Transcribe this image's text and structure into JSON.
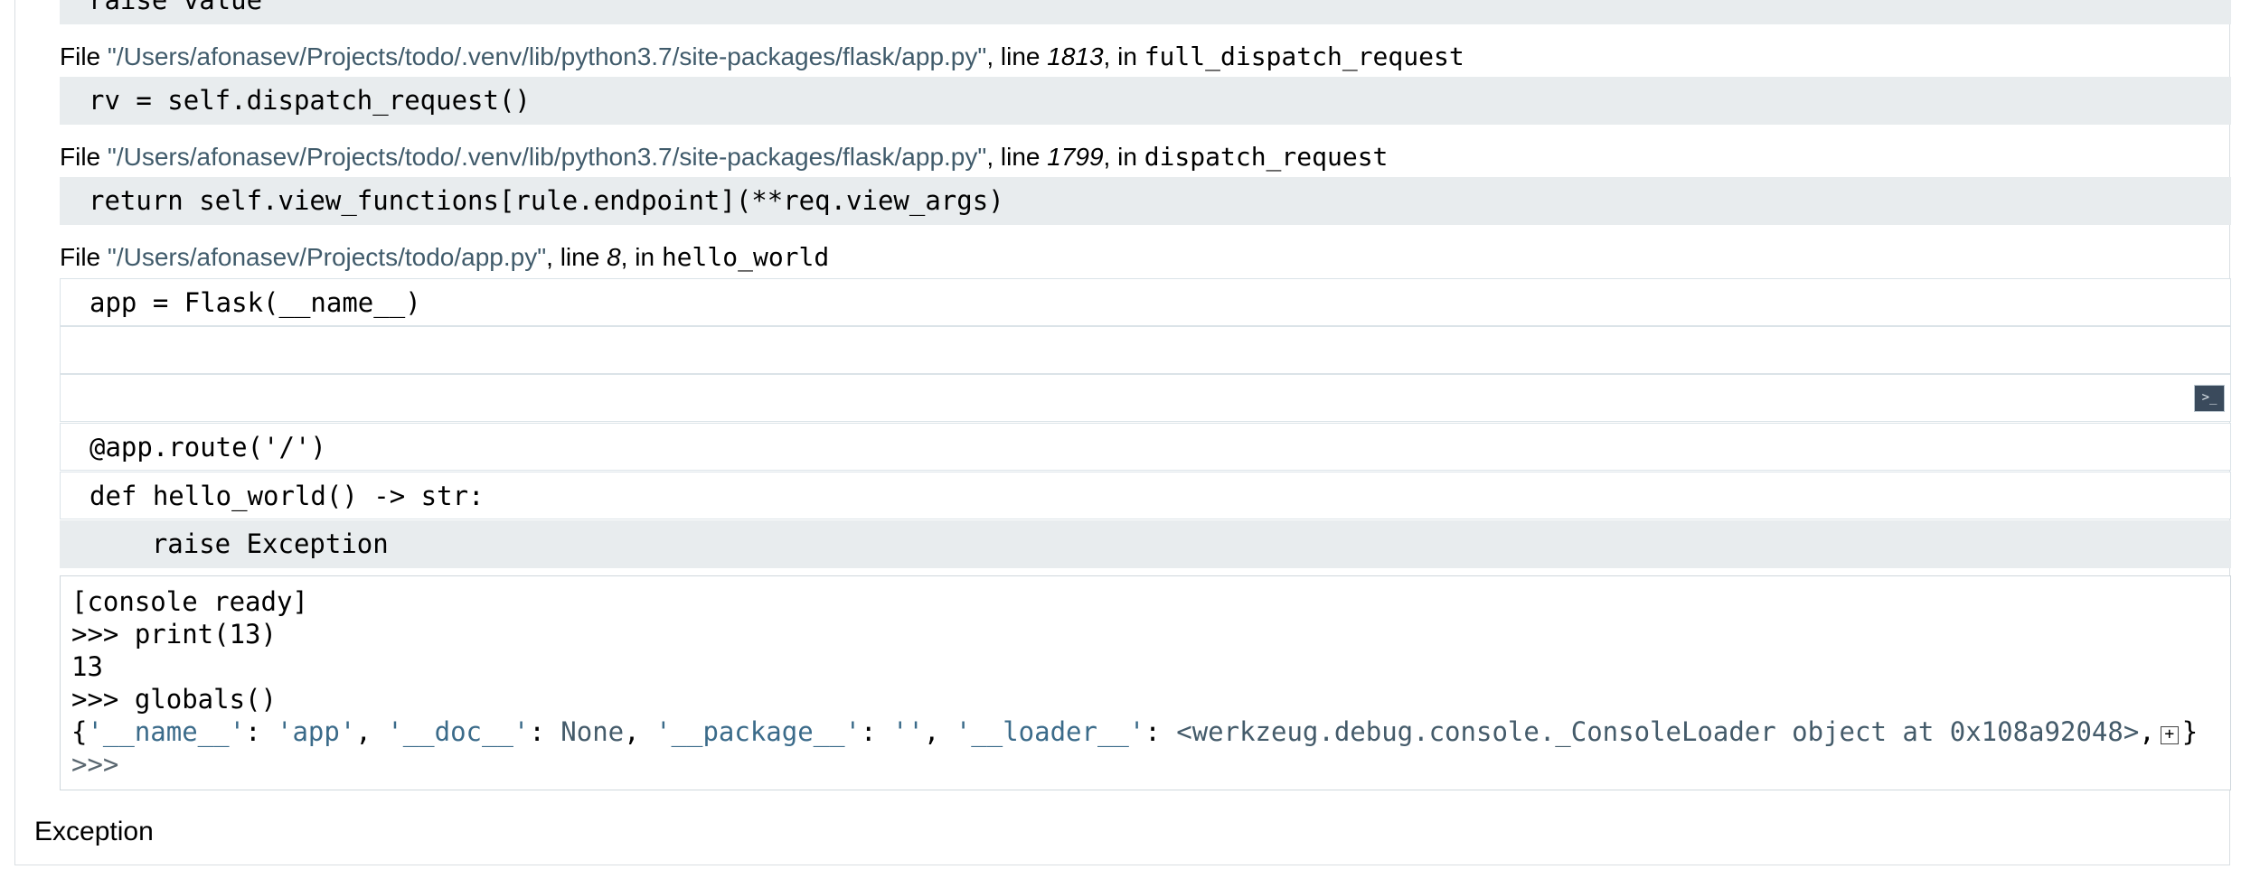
{
  "frames": [
    {
      "file_prefix": "File ",
      "path": "\"/Users/afonasev/Projects/todo/.venv/lib/python3.7/site-packages/flask/app.py\"",
      "line_word": ", line ",
      "line_no": "1813",
      "in_word": ", in ",
      "func": "full_dispatch_request",
      "code": "rv = self.dispatch_request()"
    },
    {
      "file_prefix": "File ",
      "path": "\"/Users/afonasev/Projects/todo/.venv/lib/python3.7/site-packages/flask/app.py\"",
      "line_word": ", line ",
      "line_no": "1799",
      "in_word": ", in ",
      "func": "dispatch_request",
      "code": "return self.view_functions[rule.endpoint](**req.view_args)"
    },
    {
      "file_prefix": "File ",
      "path": "\"/Users/afonasev/Projects/todo/app.py\"",
      "line_word": ", line ",
      "line_no": "8",
      "in_word": ", in ",
      "func": "hello_world",
      "context": [
        "app = Flask(__name__)",
        "",
        "",
        "@app.route('/')",
        "def hello_world() -> str:"
      ],
      "code": "    raise Exception"
    }
  ],
  "top_partial_code": "raise value",
  "console": {
    "button_icon": "terminal-icon",
    "ready": "[console ready]",
    "cmd1": ">>> print(13)",
    "out1": "13",
    "cmd2": ">>> globals()",
    "globals": {
      "open": "{",
      "k1": "'__name__'",
      "sep1": ": ",
      "v1": "'app'",
      "c1": ", ",
      "k2": "'__doc__'",
      "sep2": ": ",
      "v2": "None",
      "c2": ", ",
      "k3": "'__package__'",
      "sep3": ": ",
      "v3": "''",
      "c3": ", ",
      "k4": "'__loader__'",
      "sep4": ": ",
      "v4": "<werkzeug.debug.console._ConsoleLoader object at 0x108a92048>",
      "c4": ",",
      "expand": "+",
      "close": "}"
    },
    "prompt": ">>>"
  },
  "exception_label": "Exception"
}
